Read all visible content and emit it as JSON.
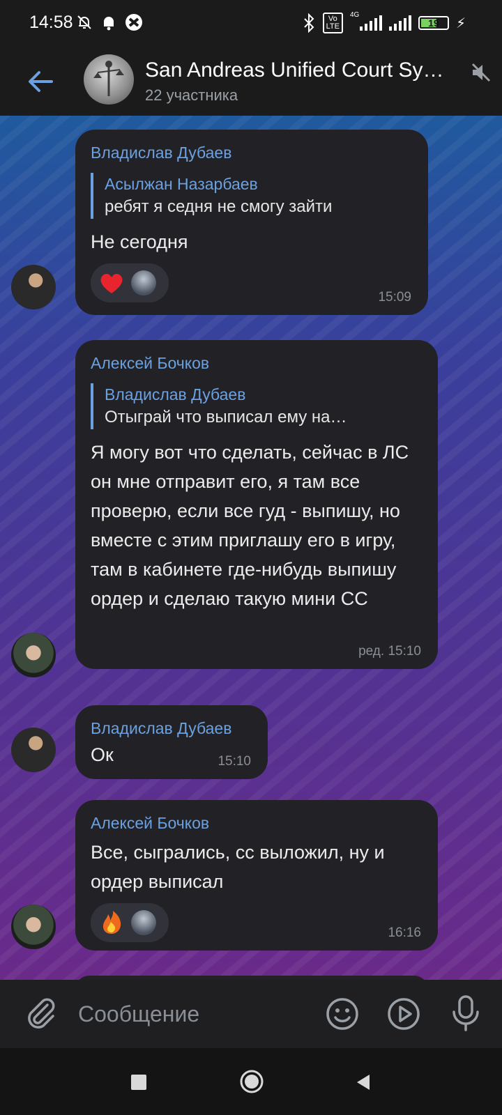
{
  "status_bar": {
    "time": "14:58",
    "network_label": "4G",
    "volte_label": "Vo\nLTE",
    "battery_level": "19",
    "icons": [
      "do-not-disturb-icon",
      "notification-bell-icon",
      "vpn-icon",
      "bluetooth-icon",
      "volte-icon",
      "signal-icon",
      "signal-icon-2",
      "battery-icon",
      "charging-icon"
    ]
  },
  "header": {
    "title": "San Andreas Unified Court Sy…",
    "subtitle": "22 участника",
    "icons": [
      "back-arrow-icon",
      "mute-icon"
    ]
  },
  "messages": [
    {
      "sender": "Владислав Дубаев",
      "reply_to_name": "Асылжан Назарбаев",
      "reply_to_text": "ребят я седня не смогу зайти",
      "text": "Не сегодня",
      "reaction": "heart-icon",
      "time": "15:09"
    },
    {
      "sender": "Алексей Бочков",
      "reply_to_name": "Владислав Дубаев",
      "reply_to_text": "Отыграй что выписал ему на…",
      "text": "Я могу вот что сделать, сейчас в ЛС он мне отправит его, я там все проверю, если все гуд - выпишу, но вместе с этим приглашу его в игру, там в кабинете где-нибудь выпишу ордер и сделаю такую мини СС",
      "time": "ред. 15:10"
    },
    {
      "sender": "Владислав Дубаев",
      "text": "Ок",
      "time": "15:10"
    },
    {
      "sender": "Алексей Бочков",
      "text": "Все, сыгрались, сс выложил, ну и ордер выписал",
      "reaction": "fire-icon",
      "time": "16:16"
    }
  ],
  "input": {
    "placeholder": "Сообщение",
    "icons": [
      "attach-icon",
      "emoji-icon",
      "gif-icon",
      "microphone-icon"
    ]
  },
  "colors": {
    "accent": "#6ba1e0",
    "bubble": "#222226",
    "header": "#1b1b1b",
    "battery_fill": "#7ad15f"
  }
}
